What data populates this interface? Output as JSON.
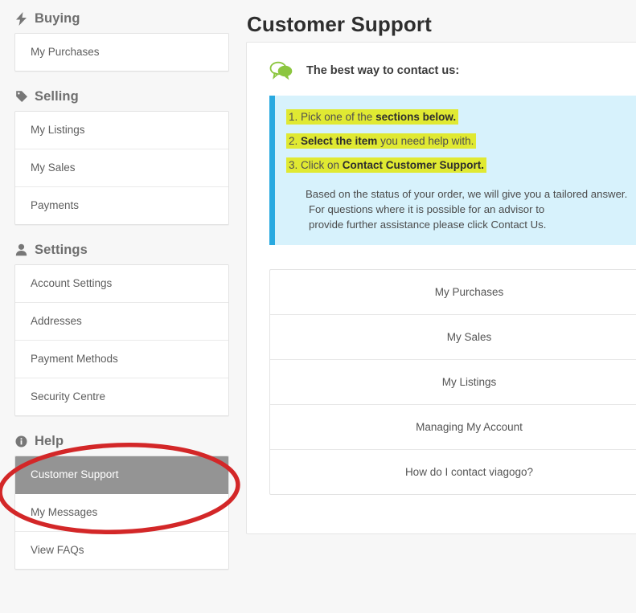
{
  "sidebar": {
    "groups": [
      {
        "title": "Buying",
        "icon": "lightning-bolt-icon",
        "items": [
          {
            "label": "My Purchases",
            "selected": false
          }
        ]
      },
      {
        "title": "Selling",
        "icon": "tag-icon",
        "items": [
          {
            "label": "My Listings",
            "selected": false
          },
          {
            "label": "My Sales",
            "selected": false
          },
          {
            "label": "Payments",
            "selected": false
          }
        ]
      },
      {
        "title": "Settings",
        "icon": "user-icon",
        "items": [
          {
            "label": "Account Settings",
            "selected": false
          },
          {
            "label": "Addresses",
            "selected": false
          },
          {
            "label": "Payment Methods",
            "selected": false
          },
          {
            "label": "Security Centre",
            "selected": false
          }
        ]
      },
      {
        "title": "Help",
        "icon": "info-circle-icon",
        "items": [
          {
            "label": "Customer Support",
            "selected": true
          },
          {
            "label": "My Messages",
            "selected": false
          },
          {
            "label": "View FAQs",
            "selected": false
          }
        ]
      }
    ]
  },
  "main": {
    "page_title": "Customer Support",
    "contact": {
      "icon": "chat-bubbles-icon",
      "headline": "The best way to contact us:"
    },
    "info_box": {
      "steps": [
        {
          "prefix": "1. Pick one of the ",
          "bold": "sections below.",
          "suffix": ""
        },
        {
          "prefix": "2. ",
          "bold": "Select the item",
          "suffix": " you need help with."
        },
        {
          "prefix": "3. Click on ",
          "bold": "Contact Customer Support.",
          "suffix": ""
        }
      ],
      "note_lines": [
        "Based on the status of your order, we will give you a tailored answer.",
        "For questions where it is possible for an advisor to",
        "provide further assistance please click Contact Us."
      ]
    },
    "options": [
      "My Purchases",
      "My Sales",
      "My Listings",
      "Managing My Account",
      "How do I contact viagogo?"
    ]
  },
  "annotation": {
    "type": "red-ellipse-highlight",
    "color": "#d32728",
    "targets": "Help / Customer Support"
  },
  "colors": {
    "page_background": "#f7f7f7",
    "card_background": "#ffffff",
    "selected_item": "#949494",
    "info_box_background": "#d7f2fc",
    "info_box_border": "#29a9e0",
    "highlight": "#e0e932",
    "accent_green": "#7ac143",
    "annotation_red": "#d32728"
  }
}
